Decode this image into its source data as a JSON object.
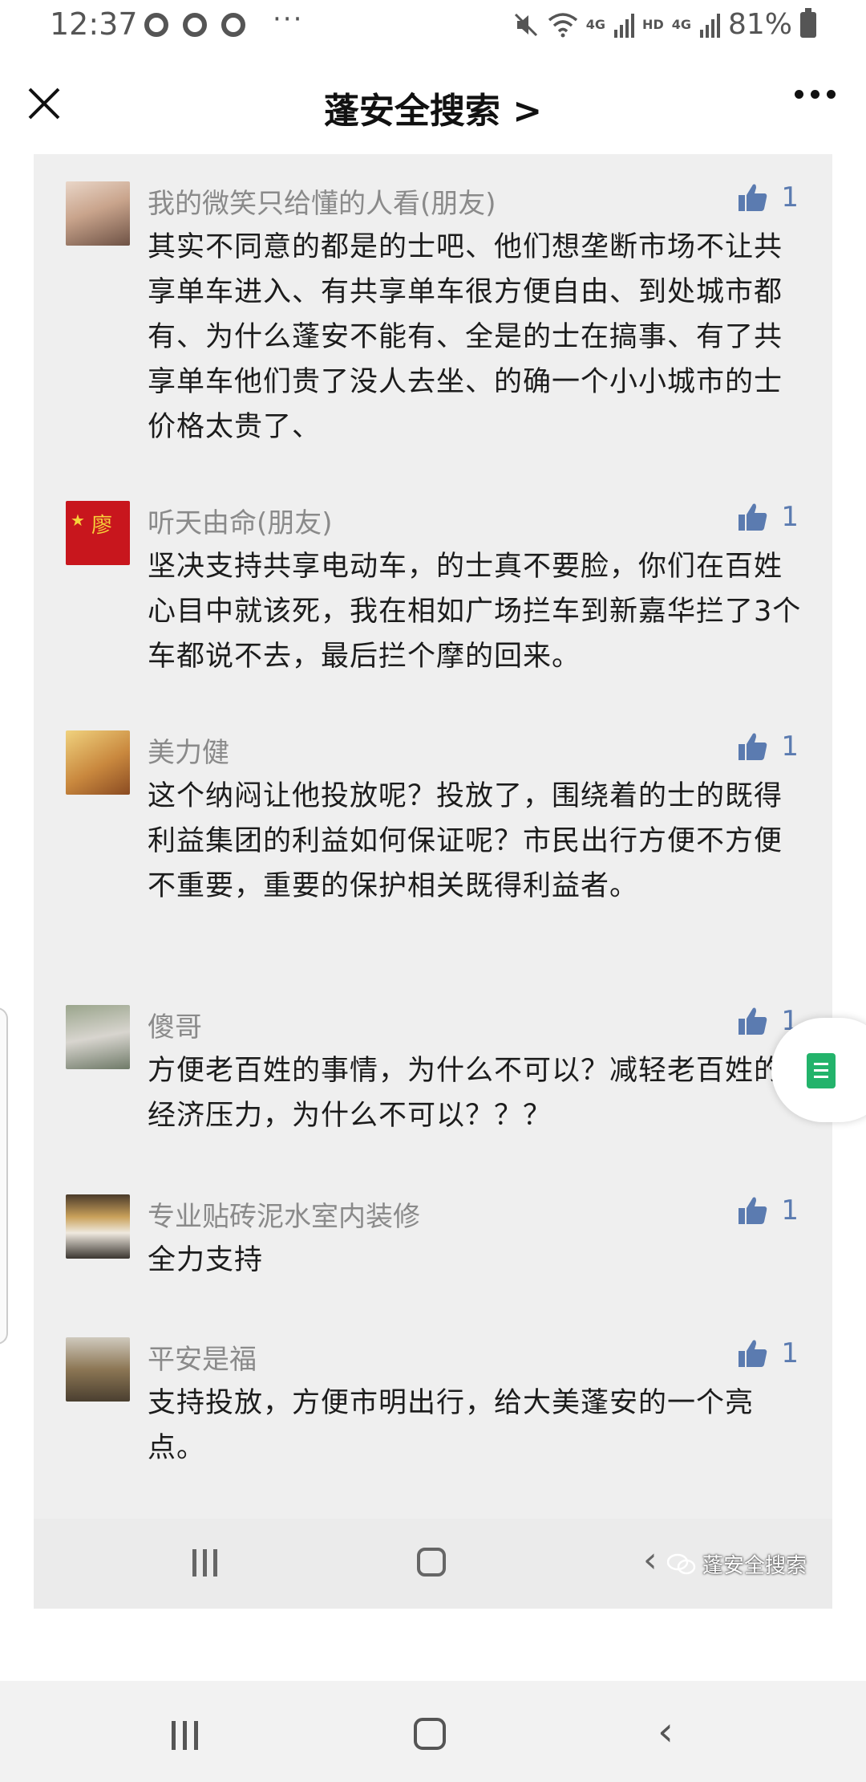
{
  "status_bar": {
    "time": "12:37",
    "dots": "···",
    "network_hd": "HD",
    "network_4g_1": "4G",
    "network_4g_2": "4G",
    "battery": "81%"
  },
  "header": {
    "title": "蓬安全搜索 >"
  },
  "comments": [
    {
      "author": "我的微笑只给懂的人看(朋友)",
      "likes": "1",
      "text": "其实不同意的都是的士吧、他们想垄断市场不让共享单车进入、有共享单车很方便自由、到处城市都有、为什么蓬安不能有、全是的士在搞事、有了共享单车他们贵了没人去坐、的确一个小小城市的士价格太贵了、"
    },
    {
      "author": "听天由命(朋友)",
      "likes": "1",
      "text": "坚决支持共享电动车，的士真不要脸，你们在百姓心目中就该死，我在相如广场拦车到新嘉华拦了3个车都说不去，最后拦个摩的回来。",
      "avatar_text": "廖"
    },
    {
      "author": "美力健",
      "likes": "1",
      "text": "这个纳闷让他投放呢？投放了，围绕着的士的既得利益集团的利益如何保证呢？市民出行方便不方便不重要，重要的保护相关既得利益者。"
    },
    {
      "author": "傻哥",
      "likes": "1",
      "text": "方便老百姓的事情，为什么不可以？减轻老百姓的经济压力，为什么不可以？？？"
    },
    {
      "author": "专业贴砖泥水室内装修",
      "likes": "1",
      "text": "全力支持"
    },
    {
      "author": "平安是福",
      "likes": "1",
      "text": "支持投放，方便市明出行，给大美蓬安的一个亮点。"
    }
  ],
  "watermark": "蓬安全搜索",
  "colors": {
    "panel_bg": "#efefef",
    "like_blue": "#5b7bb0",
    "author_gray": "#8a8a8a",
    "float_green": "#23b36b"
  }
}
